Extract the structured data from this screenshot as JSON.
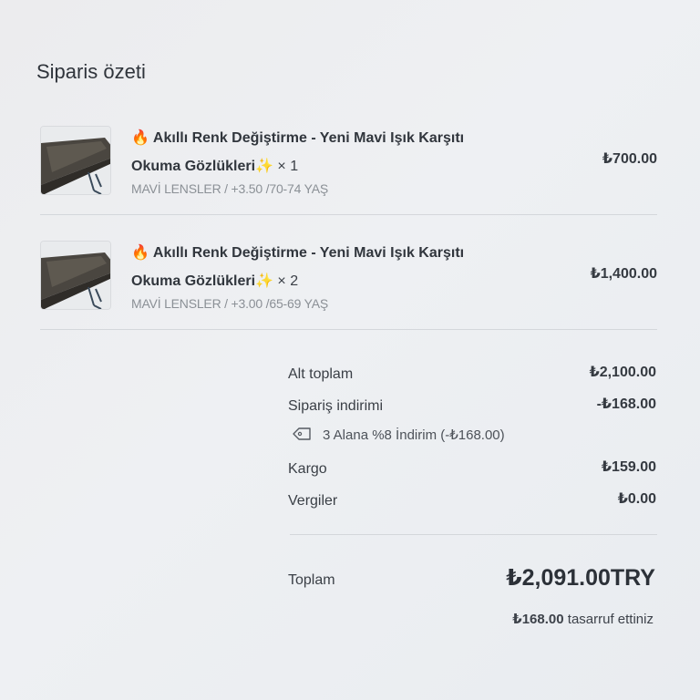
{
  "summary_heading": "Siparis özeti",
  "items": [
    {
      "fire": "🔥",
      "title_line1": "Akıllı Renk Değiştirme - Yeni Mavi Işık Karşıtı",
      "title_line2": "Okuma Gözlükleri",
      "sparkle": "✨",
      "quantity": "× 1",
      "variant": "MAVİ LENSLER / +3.50 /70-74 YAŞ",
      "price": "₺700.00",
      "image_icon": "reading-glasses-icon"
    },
    {
      "fire": "🔥",
      "title_line1": "Akıllı Renk Değiştirme - Yeni Mavi Işık Karşıtı",
      "title_line2": "Okuma Gözlükleri",
      "sparkle": "✨",
      "quantity": "× 2",
      "variant": "MAVİ LENSLER / +3.00 /65-69 YAŞ",
      "price": "₺1,400.00",
      "image_icon": "reading-glasses-icon"
    }
  ],
  "totals": {
    "subtotal_label": "Alt toplam",
    "subtotal_value": "₺2,100.00",
    "order_discount_label": "Sipariş indirimi",
    "order_discount_value": "-₺168.00",
    "discount_detail": "3 Alana %8 İndirim (-₺168.00)",
    "discount_icon": "tag-icon",
    "shipping_label": "Kargo",
    "shipping_value": "₺159.00",
    "taxes_label": "Vergiler",
    "taxes_value": "₺0.00",
    "total_label": "Toplam",
    "total_value": "₺2,091.00TRY",
    "savings_amount": "₺168.00",
    "savings_text": "tasarruf ettiniz"
  }
}
